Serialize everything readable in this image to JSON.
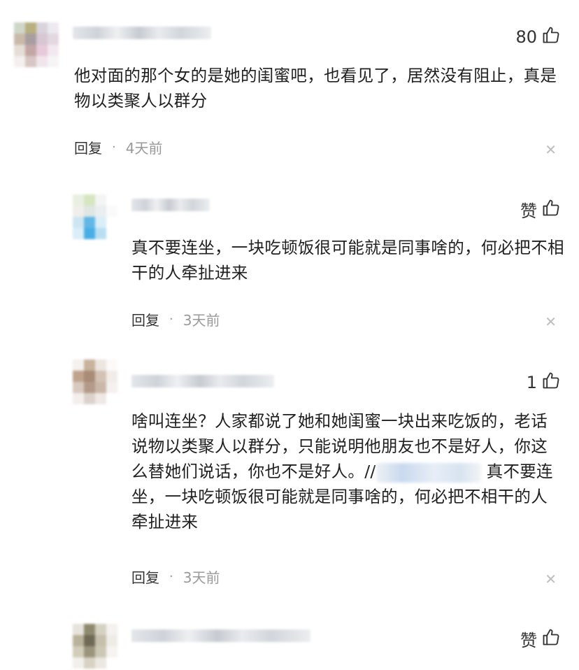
{
  "comments": [
    {
      "likes": "80",
      "text": "他对面的那个女的是她的闺蜜吧，也看见了，居然没有阻止，真是物以类聚人以群分",
      "reply_label": "回复",
      "time": "4天前"
    },
    {
      "likes": "赞",
      "text": "真不要连坐，一块吃顿饭很可能就是同事啥的，何必把不相干的人牵扯进来",
      "reply_label": "回复",
      "time": "3天前"
    },
    {
      "likes": "1",
      "text_main": "啥叫连坐？人家都说了她和她闺蜜一块出来吃饭的，老话说物以类聚人以群分，只能说明他朋友也不是好人，你这么替她们说话，你也不是好人。//",
      "text_quote": "真不要连坐，一块吃顿饭很可能就是同事啥的，何必把不相干的人牵扯进来",
      "reply_label": "回复",
      "time": "3天前"
    },
    {
      "likes": "赞"
    }
  ],
  "icons": {
    "like": "thumbs-up-icon",
    "close": "close-icon",
    "separator": "dot"
  },
  "colors": {
    "text": "#1f1f1f",
    "meta": "#999999",
    "close": "#bdbdbd"
  }
}
